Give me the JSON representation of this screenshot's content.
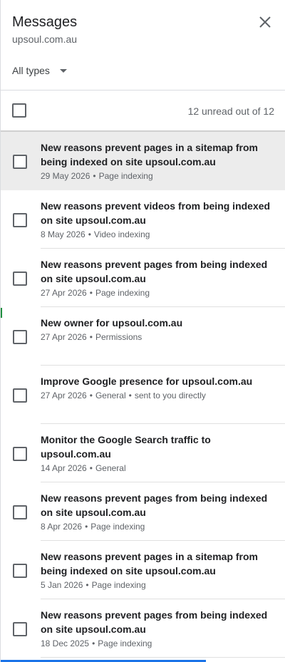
{
  "header": {
    "title": "Messages",
    "subtitle": "upsoul.com.au",
    "close_icon": "close-icon"
  },
  "filter": {
    "selected": "All types",
    "dropdown_icon": "arrow-drop-down-icon"
  },
  "summary": {
    "unread_text": "12 unread out of 12"
  },
  "progress": {
    "fraction": 0.72,
    "color": "#1a73e8"
  },
  "messages": [
    {
      "title": "New reasons prevent pages in a sitemap from being indexed on site upsoul.com.au",
      "date": "29 May 2026",
      "category": "Page indexing",
      "extra": ""
    },
    {
      "title": "New reasons prevent videos from being indexed on site upsoul.com.au",
      "date": "8 May 2026",
      "category": "Video indexing",
      "extra": ""
    },
    {
      "title": "New reasons prevent pages from being indexed on site upsoul.com.au",
      "date": "27 Apr 2026",
      "category": "Page indexing",
      "extra": ""
    },
    {
      "title": "New owner for upsoul.com.au",
      "date": "27 Apr 2026",
      "category": "Permissions",
      "extra": ""
    },
    {
      "title": "Improve Google presence for upsoul.com.au",
      "date": "27 Apr 2026",
      "category": "General",
      "extra": "sent to you directly"
    },
    {
      "title": "Monitor the Google Search traffic to upsoul.com.au",
      "date": "14 Apr 2026",
      "category": "General",
      "extra": ""
    },
    {
      "title": "New reasons prevent pages from being indexed on site upsoul.com.au",
      "date": "8 Apr 2026",
      "category": "Page indexing",
      "extra": ""
    },
    {
      "title": "New reasons prevent pages in a sitemap from being indexed on site upsoul.com.au",
      "date": "5 Jan 2026",
      "category": "Page indexing",
      "extra": ""
    },
    {
      "title": "New reasons prevent pages from being indexed on site upsoul.com.au",
      "date": "18 Dec 2025",
      "category": "Page indexing",
      "extra": ""
    }
  ]
}
